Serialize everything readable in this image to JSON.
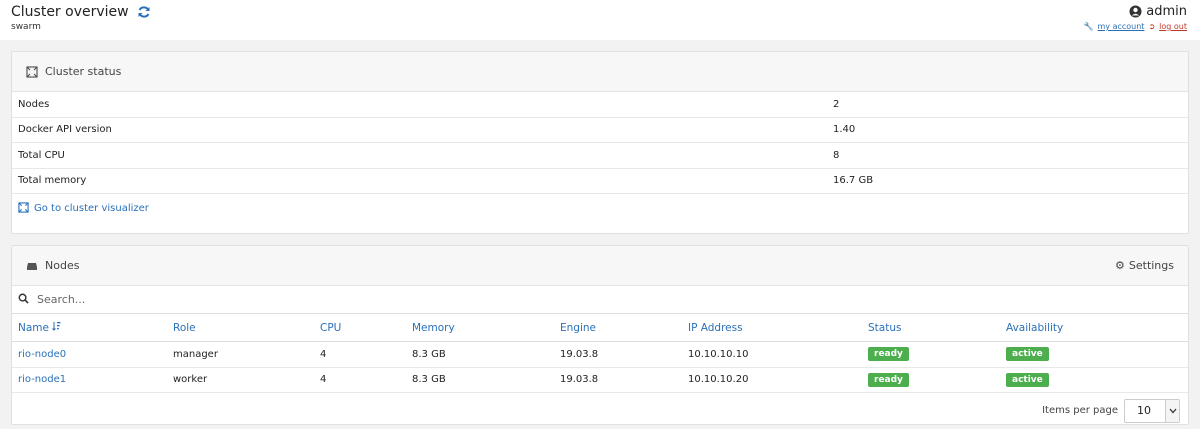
{
  "header": {
    "title": "Cluster overview",
    "subtitle": "swarm",
    "user": "admin",
    "my_account": "my account",
    "log_out": "log out"
  },
  "cluster_status": {
    "title": "Cluster status",
    "rows": [
      {
        "key": "Nodes",
        "value": "2"
      },
      {
        "key": "Docker API version",
        "value": "1.40"
      },
      {
        "key": "Total CPU",
        "value": "8"
      },
      {
        "key": "Total memory",
        "value": "16.7 GB"
      }
    ],
    "visualizer_link": "Go to cluster visualizer"
  },
  "nodes": {
    "title": "Nodes",
    "settings_label": "Settings",
    "search_placeholder": "Search...",
    "columns": [
      "Name",
      "Role",
      "CPU",
      "Memory",
      "Engine",
      "IP Address",
      "Status",
      "Availability"
    ],
    "rows": [
      {
        "name": "rio-node0",
        "role": "manager",
        "cpu": "4",
        "memory": "8.3 GB",
        "engine": "19.03.8",
        "ip": "10.10.10.10",
        "status": "ready",
        "availability": "active"
      },
      {
        "name": "rio-node1",
        "role": "worker",
        "cpu": "4",
        "memory": "8.3 GB",
        "engine": "19.03.8",
        "ip": "10.10.10.20",
        "status": "ready",
        "availability": "active"
      }
    ],
    "items_per_page_label": "Items per page",
    "items_per_page_value": "10"
  },
  "colors": {
    "link": "#2a70b8",
    "badge_green": "#4cae4c",
    "logout_red": "#c0392b"
  }
}
